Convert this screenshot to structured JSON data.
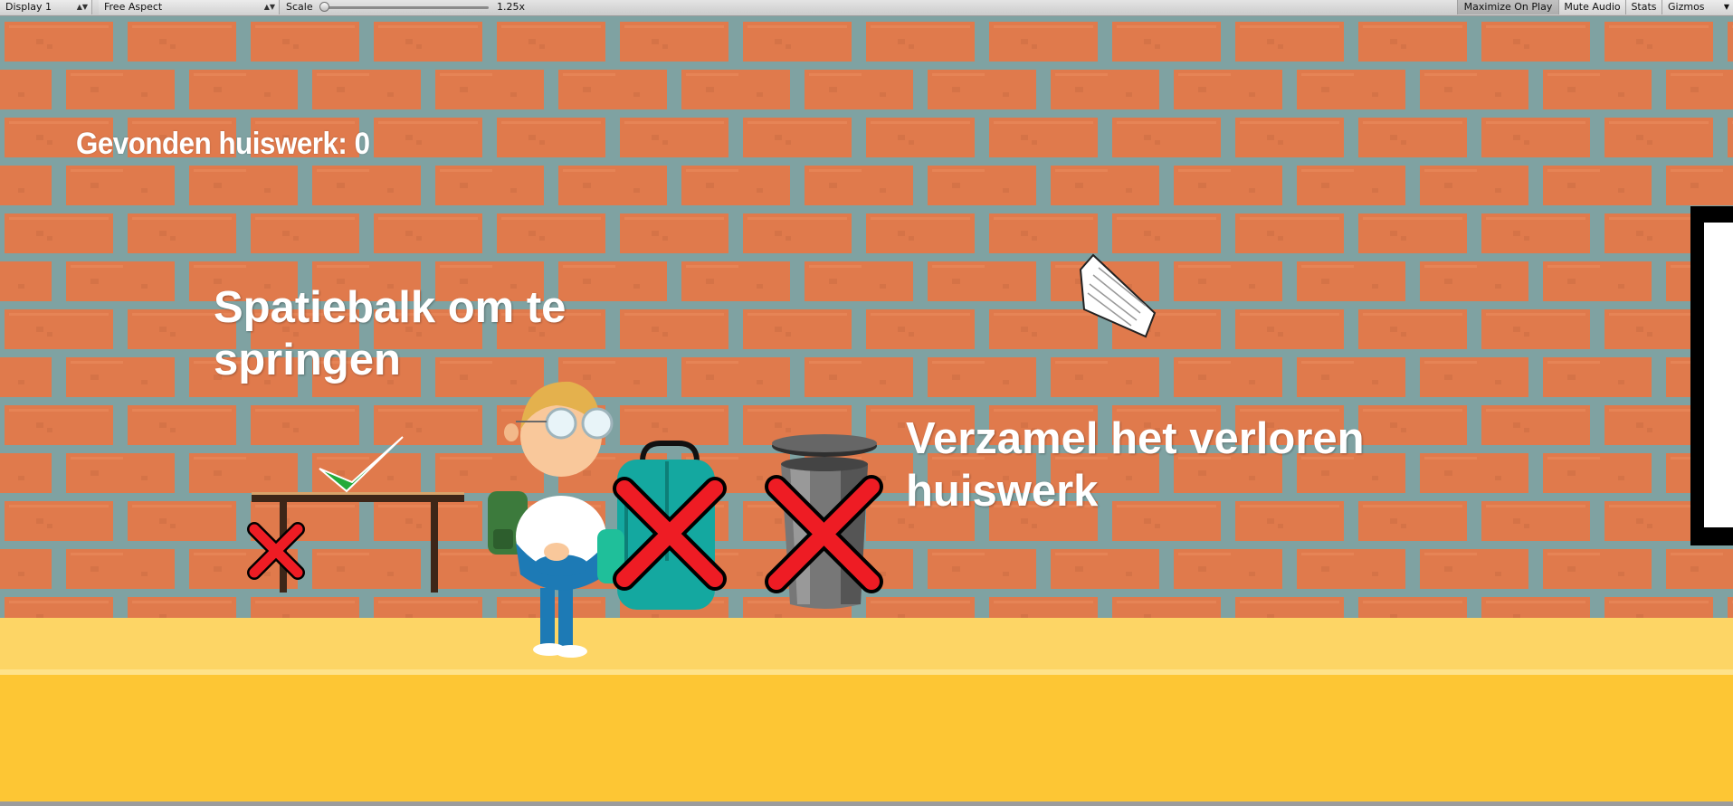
{
  "toolbar": {
    "display": "Display 1",
    "aspect": "Free Aspect",
    "scale_label": "Scale",
    "scale_value": "1.25x",
    "maximize_on_play": "Maximize On Play",
    "mute_audio": "Mute Audio",
    "stats": "Stats",
    "gizmos": "Gizmos"
  },
  "hud": {
    "score_text": "Gevonden huiswerk: 0",
    "jump_hint": "Spatiebalk om te springen",
    "collect_hint": "Verzamel het verloren huiswerk"
  },
  "colors": {
    "brick": "#e07a4c",
    "mortar": "#7fa2a2",
    "floor_top": "#fdd565",
    "floor_bottom": "#fdc634",
    "cross": "#ee1c24",
    "check": "#22aa3a",
    "text": "#ffffff"
  },
  "icons": [
    "checkmark-icon",
    "red-cross-icon",
    "homework-paper-icon"
  ]
}
